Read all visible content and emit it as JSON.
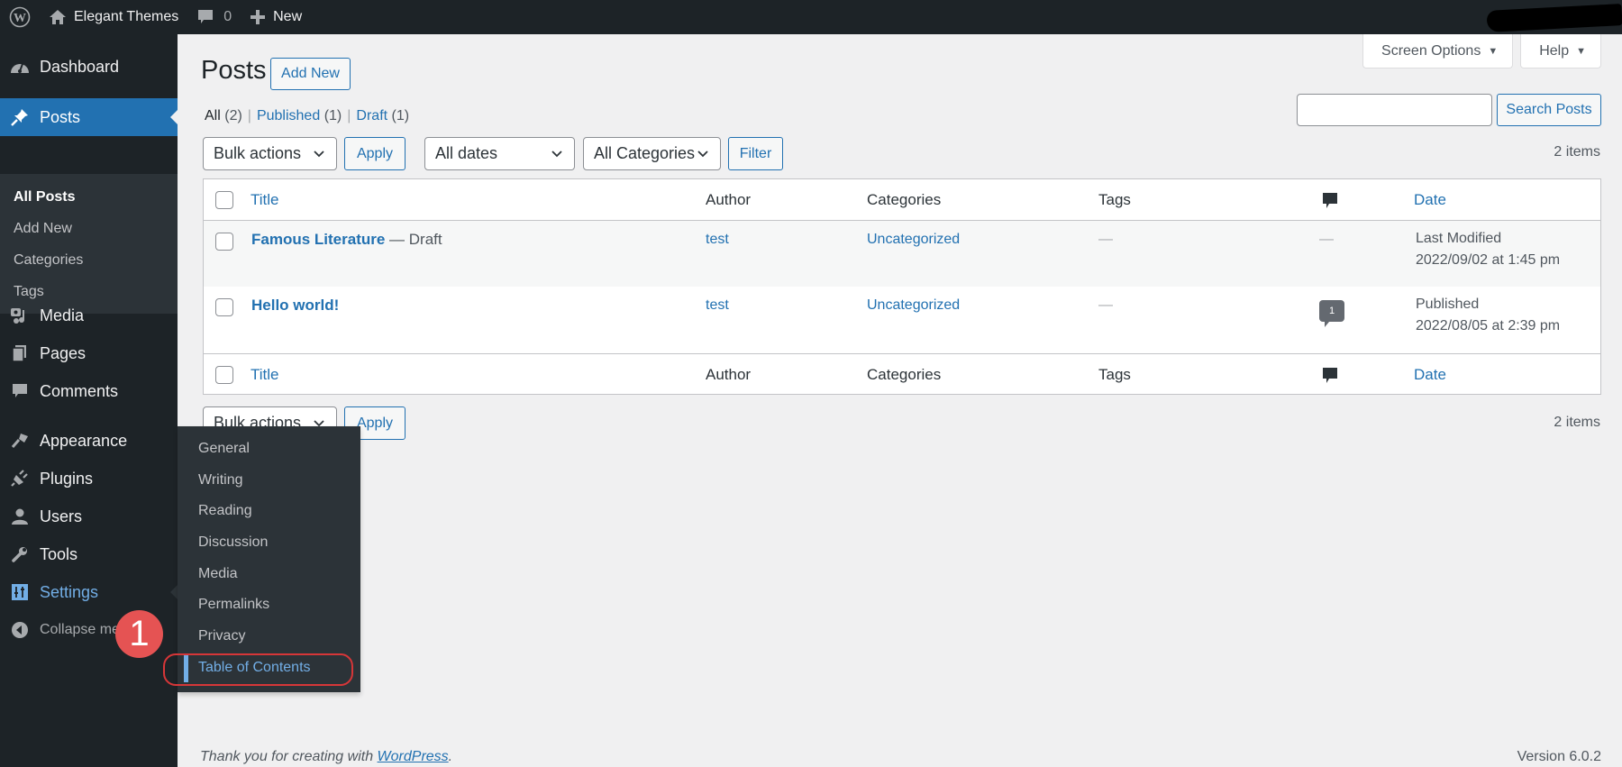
{
  "adminbar": {
    "site_name": "Elegant Themes",
    "comments_count": "0",
    "new_label": "New",
    "icons": {
      "logo": "wordpress-logo-icon",
      "home": "home-icon",
      "comments": "comment-bubble-icon",
      "new": "plus-icon"
    }
  },
  "sidebar": {
    "items": [
      {
        "label": "Dashboard",
        "icon": "dashboard-gauge-icon"
      },
      {
        "label": "Posts",
        "icon": "pushpin-icon"
      },
      {
        "label": "Media",
        "icon": "media-icon"
      },
      {
        "label": "Pages",
        "icon": "pages-icon"
      },
      {
        "label": "Comments",
        "icon": "comment-icon"
      },
      {
        "label": "Appearance",
        "icon": "paintbrush-icon"
      },
      {
        "label": "Plugins",
        "icon": "plug-icon"
      },
      {
        "label": "Users",
        "icon": "user-icon"
      },
      {
        "label": "Tools",
        "icon": "wrench-icon"
      },
      {
        "label": "Settings",
        "icon": "sliders-icon"
      },
      {
        "label": "Collapse menu",
        "icon": "collapse-arrow-icon"
      }
    ],
    "posts_submenu": [
      "All Posts",
      "Add New",
      "Categories",
      "Tags"
    ],
    "settings_flyout": [
      "General",
      "Writing",
      "Reading",
      "Discussion",
      "Media",
      "Permalinks",
      "Privacy",
      "Table of Contents"
    ]
  },
  "annotation": {
    "badge": "1",
    "color": "#e55353",
    "ring_color": "#d63638"
  },
  "header": {
    "screen_options": "Screen Options",
    "help": "Help",
    "title": "Posts",
    "add_new": "Add New"
  },
  "filters": {
    "all": "All",
    "all_count": "(2)",
    "published": "Published",
    "published_count": "(1)",
    "draft": "Draft",
    "draft_count": "(1)",
    "sep": "|"
  },
  "search": {
    "value": "",
    "button": "Search Posts"
  },
  "toolbar": {
    "bulk_actions": "Bulk actions",
    "apply": "Apply",
    "dates": "All dates",
    "categories": "All Categories",
    "filter": "Filter",
    "items_count": "2 items"
  },
  "table": {
    "columns": [
      "Title",
      "Author",
      "Categories",
      "Tags",
      "comments-icon",
      "Date"
    ],
    "rows": [
      {
        "title": "Famous Literature",
        "state": " — Draft",
        "author": "test",
        "categories": "Uncategorized",
        "tags": "—",
        "comments": "—",
        "date_status": "Last Modified",
        "date": "2022/09/02 at 1:45 pm"
      },
      {
        "title": "Hello world!",
        "state": "",
        "author": "test",
        "categories": "Uncategorized",
        "tags": "—",
        "comments": "1",
        "date_status": "Published",
        "date": "2022/08/05 at 2:39 pm"
      }
    ]
  },
  "footer": {
    "thanks_prefix": "Thank you for creating with ",
    "thanks_link": "WordPress",
    "thanks_suffix": ".",
    "version": "Version 6.0.2"
  },
  "colors": {
    "accent": "#2271b1",
    "sidebar_bg": "#1d2327",
    "submenu_bg": "#2c3338",
    "highlight": "#72aee6"
  }
}
